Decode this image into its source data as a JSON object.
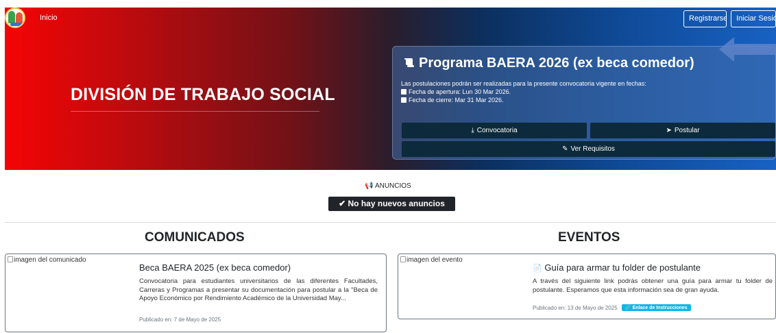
{
  "nav": {
    "home_label": "Inicio",
    "register_label": "Registrarse",
    "login_label": "Iniciar Sesión"
  },
  "hero": {
    "division_title": "DIVISIÓN DE TRABAJO SOCIAL"
  },
  "program_card": {
    "title": "Programa BAERA 2026 (ex beca comedor)",
    "intro": "Las postulaciones podrán ser realizadas para la presente convocatoria vigente en fechas:",
    "opening_date": "Fecha de apertura: Lun 30 Mar 2026.",
    "closing_date": "Fecha de cierre: Mar 31 Mar 2026.",
    "convocatoria_label": "Convocatoria",
    "postular_label": "Postular",
    "requisitos_label": "Ver Requisitos"
  },
  "announcements": {
    "heading": "ANUNCIOS",
    "empty_label": "No hay nuevos anuncios"
  },
  "comunicados": {
    "heading": "COMUNICADOS",
    "items": [
      {
        "image_alt": "imagen del comunicado",
        "title": "Beca BAERA 2025 (ex beca comedor)",
        "body": "Convocatoria para estudiantes universitarios de las diferentes Facultades, Carreras y Programas a presentar su documentación para postular a la \"Beca de Apoyo Económico por Rendimiento Académico de la Universidad May...",
        "published": "Publicado en: 7 de Mayo de 2025"
      }
    ]
  },
  "eventos": {
    "heading": "EVENTOS",
    "items": [
      {
        "image_alt": "imagen del evento",
        "title": "Guía para armar tu folder de postulante",
        "body": "A través del siguiente link podrás obtener una guía para armar tu folder de postulante. Esperamos que esta información sea de gran ayuda.",
        "published": "Publicado en: 13 de Mayo de 2025",
        "badge": "Enlace de Instrucciones"
      }
    ]
  },
  "colors": {
    "hero_red": "#f50404",
    "hero_blue": "#1762c4",
    "dark_button": "#0c2a3c",
    "badge_cyan": "#11b6e6"
  }
}
